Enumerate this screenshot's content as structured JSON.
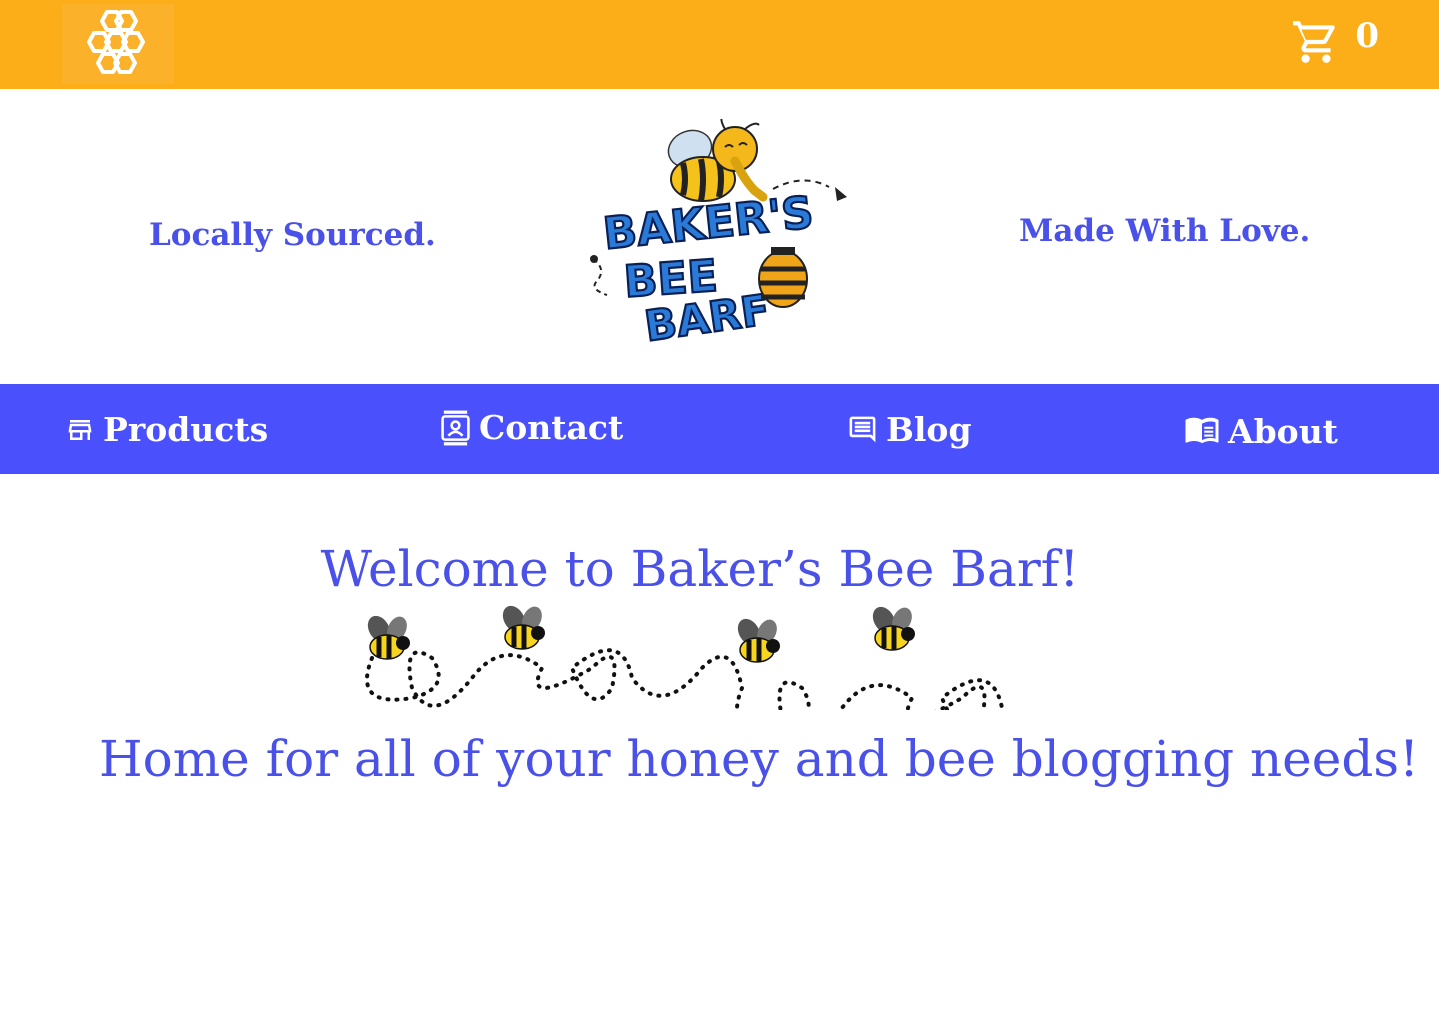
{
  "topbar": {
    "home_icon": "honeycomb-icon",
    "cart_icon": "shopping-cart-icon",
    "cart_count": "0",
    "background_color": "#fbae17"
  },
  "header": {
    "tagline_left": "Locally Sourced.",
    "tagline_right": "Made With Love.",
    "logo_text": "BAKER'S BEE BARF",
    "accent_color": "#4a51e8"
  },
  "nav": {
    "background_color": "#4a51fc",
    "items": [
      {
        "label": "Products",
        "icon": "storefront-icon"
      },
      {
        "label": "Contact",
        "icon": "contact-card-icon"
      },
      {
        "label": "Blog",
        "icon": "chat-bubble-icon"
      },
      {
        "label": "About",
        "icon": "open-book-icon"
      }
    ]
  },
  "main": {
    "welcome": "Welcome to Baker’s Bee Barf!",
    "subtitle": "Home for all of your honey and bee blogging needs!",
    "divider_image": "flying-bees-divider"
  }
}
